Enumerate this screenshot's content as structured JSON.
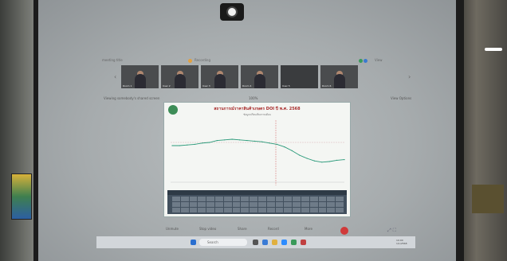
{
  "meeting": {
    "topbar_left": "meeting title",
    "topbar_rec": "Recording",
    "topbar_view": "View",
    "share_label": "Viewing somebody's shared screen",
    "zoom": "100%",
    "view_options": "View Options"
  },
  "participants": [
    {
      "name": "Room 1"
    },
    {
      "name": "User 2"
    },
    {
      "name": "User 3"
    },
    {
      "name": "Room 4"
    },
    {
      "name": "User 5"
    },
    {
      "name": "Room 6"
    }
  ],
  "slide": {
    "title": "สถานการณ์ราคาสินค้าเกษตร DOI ปี พ.ศ. 2568",
    "subtitle": "ข้อมูลเปรียบเทียบรายเดือน"
  },
  "controls": {
    "unmute": "Unmute",
    "video": "Stop video",
    "share": "Share",
    "record": "Record",
    "more": "More"
  },
  "taskbar": {
    "search_placeholder": "Search",
    "time": "10:00",
    "date": "1/1/2568"
  },
  "chart_data": {
    "type": "line",
    "series": [
      {
        "values": [
          60,
          60,
          61,
          62,
          64,
          65,
          68,
          69,
          70,
          69,
          68,
          67,
          66,
          64,
          62,
          58,
          52,
          45,
          40,
          36,
          34,
          35,
          37,
          38
        ]
      }
    ],
    "ylim": [
      0,
      100
    ]
  },
  "colors": {
    "accent": "#a82a2a",
    "line": "#2a9a7a"
  }
}
